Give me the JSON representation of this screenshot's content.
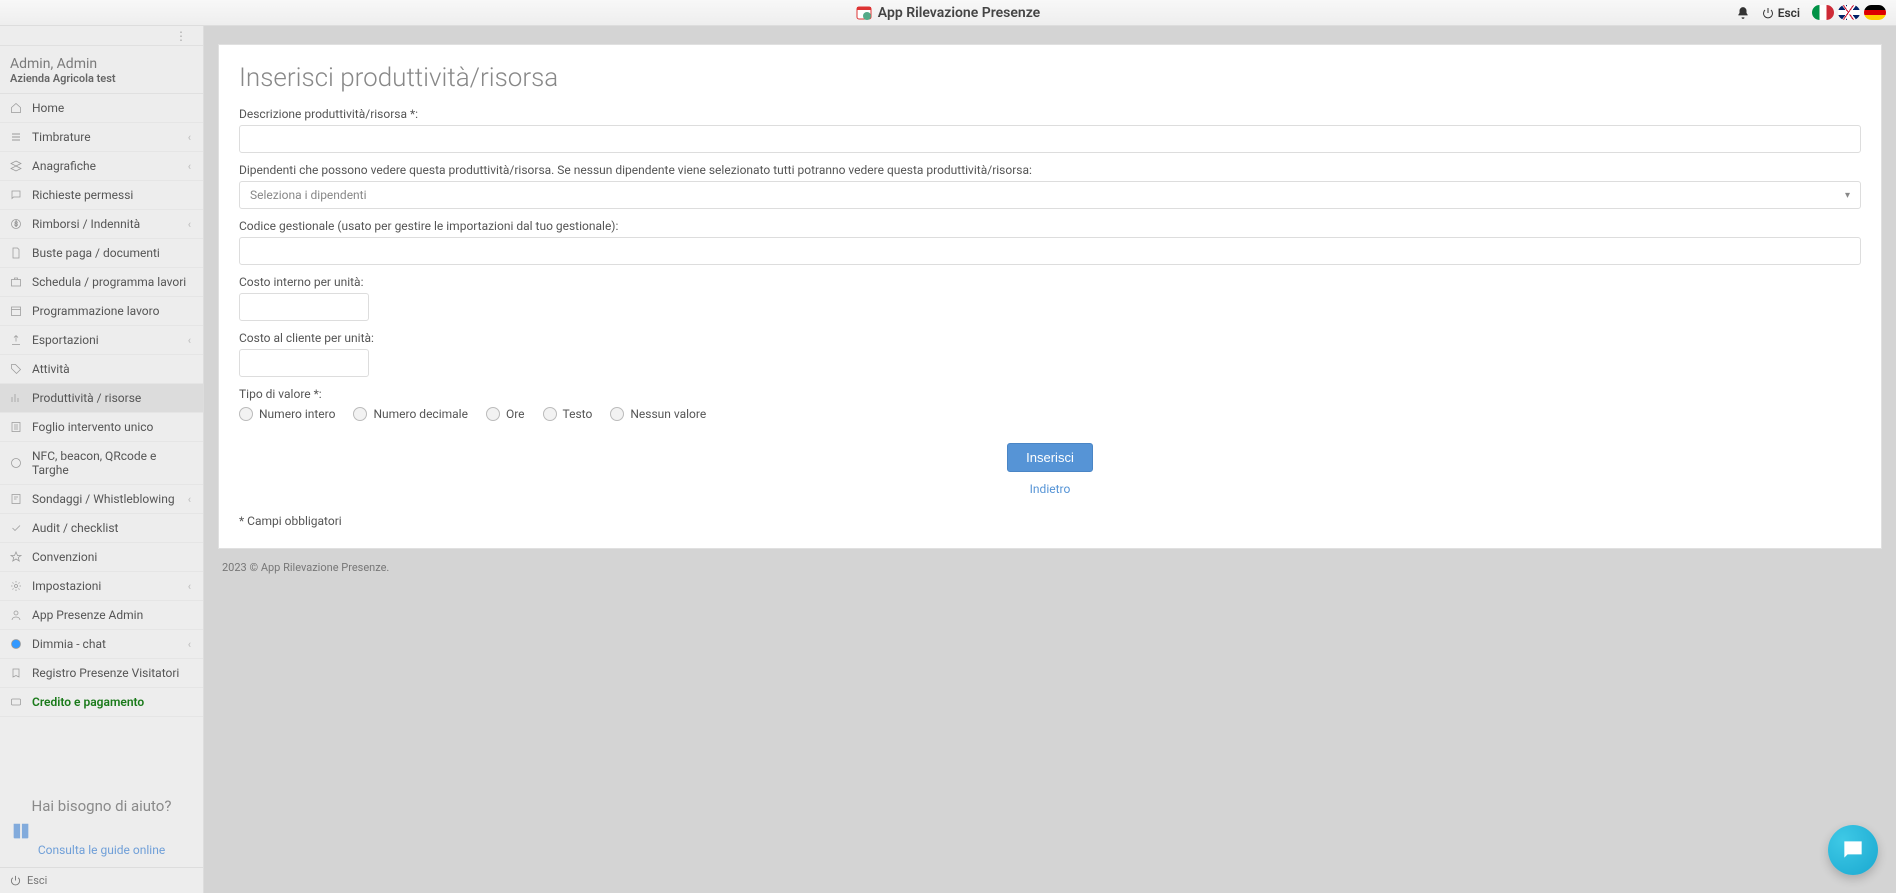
{
  "header": {
    "app_title": "App Rilevazione Presenze",
    "exit_label": "Esci"
  },
  "languages": [
    "it",
    "uk",
    "de"
  ],
  "user": {
    "name": "Admin, Admin",
    "company": "Azienda Agricola test"
  },
  "sidebar": {
    "items": [
      {
        "label": "Home",
        "icon": "home",
        "expand": false
      },
      {
        "label": "Timbrature",
        "icon": "list",
        "expand": true
      },
      {
        "label": "Anagrafiche",
        "icon": "layers",
        "expand": true
      },
      {
        "label": "Richieste permessi",
        "icon": "chat",
        "expand": false
      },
      {
        "label": "Rimborsi / Indennità",
        "icon": "money",
        "expand": true
      },
      {
        "label": "Buste paga / documenti",
        "icon": "doc",
        "expand": false
      },
      {
        "label": "Schedula / programma lavori",
        "icon": "briefcase",
        "expand": false
      },
      {
        "label": "Programmazione lavoro",
        "icon": "calendar",
        "expand": false
      },
      {
        "label": "Esportazioni",
        "icon": "export",
        "expand": true
      },
      {
        "label": "Attività",
        "icon": "tag",
        "expand": false
      },
      {
        "label": "Produttività / risorse",
        "icon": "bars",
        "expand": false,
        "active": true
      },
      {
        "label": "Foglio intervento unico",
        "icon": "sheet",
        "expand": false
      },
      {
        "label": "NFC, beacon, QRcode e Targhe",
        "icon": "nfc",
        "expand": false
      },
      {
        "label": "Sondaggi / Whistleblowing",
        "icon": "survey",
        "expand": true
      },
      {
        "label": "Audit / checklist",
        "icon": "check",
        "expand": false
      },
      {
        "label": "Convenzioni",
        "icon": "star",
        "expand": false
      },
      {
        "label": "Impostazioni",
        "icon": "gear",
        "expand": true
      },
      {
        "label": "App Presenze Admin",
        "icon": "admin",
        "expand": false
      },
      {
        "label": "Dimmia - chat",
        "icon": "dimmia",
        "expand": true
      },
      {
        "label": "Registro Presenze Visitatori",
        "icon": "visitors",
        "expand": false
      },
      {
        "label": "Credito e pagamento",
        "icon": "credit",
        "expand": false,
        "credit": true
      }
    ],
    "help_title": "Hai bisogno di aiuto?",
    "help_link": "Consulta le guide online",
    "footer_exit": "Esci"
  },
  "form": {
    "page_title": "Inserisci produttività/risorsa",
    "desc_label": "Descrizione produttività/risorsa *:",
    "employees_label": "Dipendenti che possono vedere questa produttività/risorsa. Se nessun dipendente viene selezionato tutti potranno vedere questa produttività/risorsa:",
    "employees_placeholder": "Seleziona i dipendenti",
    "code_label": "Codice gestionale (usato per gestire le importazioni dal tuo gestionale):",
    "internal_cost_label": "Costo interno per unità:",
    "client_cost_label": "Costo al cliente per unità:",
    "value_type_label": "Tipo di valore *:",
    "radio_options": [
      "Numero intero",
      "Numero decimale",
      "Ore",
      "Testo",
      "Nessun valore"
    ],
    "submit_label": "Inserisci",
    "back_label": "Indietro",
    "required_note": "* Campi obbligatori"
  },
  "footer": {
    "copyright": "2023 © App Rilevazione Presenze."
  }
}
